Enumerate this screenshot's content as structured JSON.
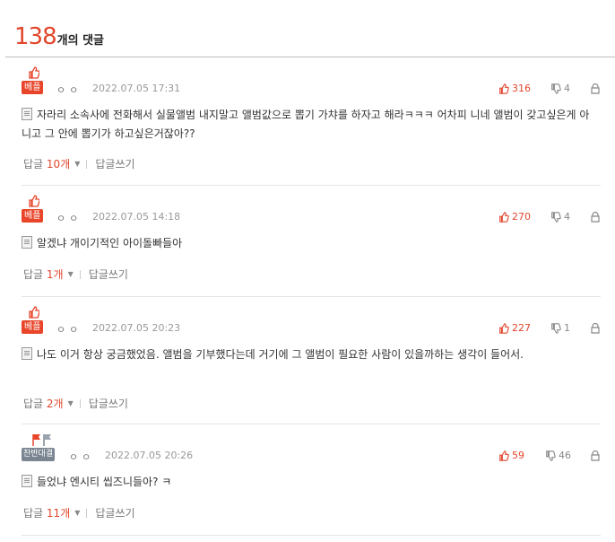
{
  "header": {
    "count": "138",
    "suffix": "개의 댓글"
  },
  "comments": [
    {
      "badge": "베플",
      "nickname": "ㅇㅇ",
      "date": "2022.07.05 17:31",
      "likes": "316",
      "dislikes": "4",
      "body": "자라리 소속사에 전화해서 실물앨범 내지말고 앨범값으로 뽑기 가챠를 하자고 해라ㅋㅋㅋ 어차피 니네 앨범이 갖고싶은게 아니고 그 안에 뽑기가 하고싶은거잖아??",
      "reply_label": "답글",
      "reply_count": "10개",
      "write_reply": "답글쓰기"
    },
    {
      "badge": "베플",
      "nickname": "ㅇㅇ",
      "date": "2022.07.05 14:18",
      "likes": "270",
      "dislikes": "4",
      "body": "알겠냐 개이기적인 아이돌빠들아",
      "reply_label": "답글",
      "reply_count": "1개",
      "write_reply": "답글쓰기"
    },
    {
      "badge": "베플",
      "nickname": "ㅇㅇ",
      "date": "2022.07.05 20:23",
      "likes": "227",
      "dislikes": "1",
      "body": "나도 이거 항상 궁금했었음. 앨범을 기부했다는데 거기에 그 앨범이 필요한 사람이 있을까하는 생각이 들어서.",
      "reply_label": "답글",
      "reply_count": "2개",
      "write_reply": "답글쓰기"
    },
    {
      "badge": "찬반대결",
      "nickname": "ㅇㅇ",
      "date": "2022.07.05 20:26",
      "likes": "59",
      "dislikes": "46",
      "body": "들었냐 엔시티 씹즈니들아? ㅋ",
      "reply_label": "답글",
      "reply_count": "11개",
      "write_reply": "답글쓰기"
    }
  ],
  "colors": {
    "accent": "#e2462d",
    "badge_best": "#e8452a",
    "badge_versus": "#7b8591"
  }
}
